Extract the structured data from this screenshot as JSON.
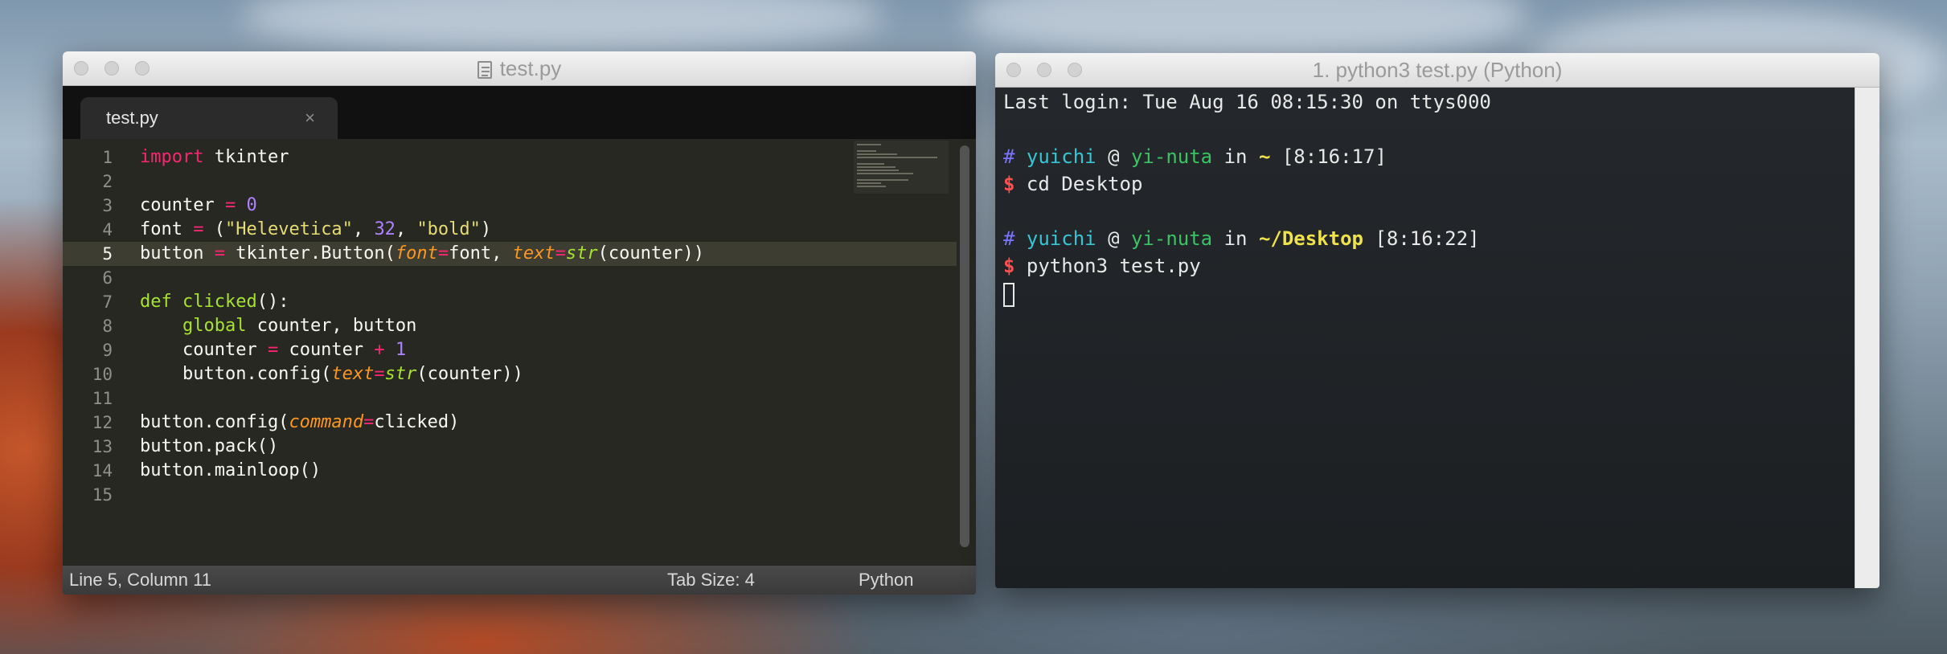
{
  "editor": {
    "window_title": "test.py",
    "tab_label": "test.py",
    "tab_close": "×",
    "line_numbers": [
      "1",
      "2",
      "3",
      "4",
      "5",
      "6",
      "7",
      "8",
      "9",
      "10",
      "11",
      "12",
      "13",
      "14",
      "15"
    ],
    "active_line": 5,
    "status": {
      "position": "Line 5, Column 11",
      "tab_size": "Tab Size: 4",
      "syntax": "Python"
    }
  },
  "terminal": {
    "window_title": "1. python3 test.py (Python)",
    "last_login": "Last login: Tue Aug 16 08:15:30 on ttys000",
    "prompt1": {
      "hash": "#",
      "user": "yuichi",
      "at": "@",
      "host": "yi-nuta",
      "in": "in",
      "path": "~",
      "time": "[8:16:17]"
    },
    "command1": {
      "dollar": "$",
      "cmd": "cd Desktop"
    },
    "prompt2": {
      "hash": "#",
      "user": "yuichi",
      "at": "@",
      "host": "yi-nuta",
      "in": "in",
      "path": "~/Desktop",
      "time": "[8:16:22]"
    },
    "command2": {
      "dollar": "$",
      "cmd": "python3 test.py"
    }
  },
  "colors": {
    "keyword": "#f92672",
    "number": "#ae81ff",
    "string": "#e6db74",
    "function": "#a6e22e",
    "parameter": "#fd971f",
    "terminal_user": "#35c6d6",
    "terminal_host": "#39c463",
    "terminal_path": "#f0e24a",
    "terminal_dollar": "#ff5050"
  }
}
